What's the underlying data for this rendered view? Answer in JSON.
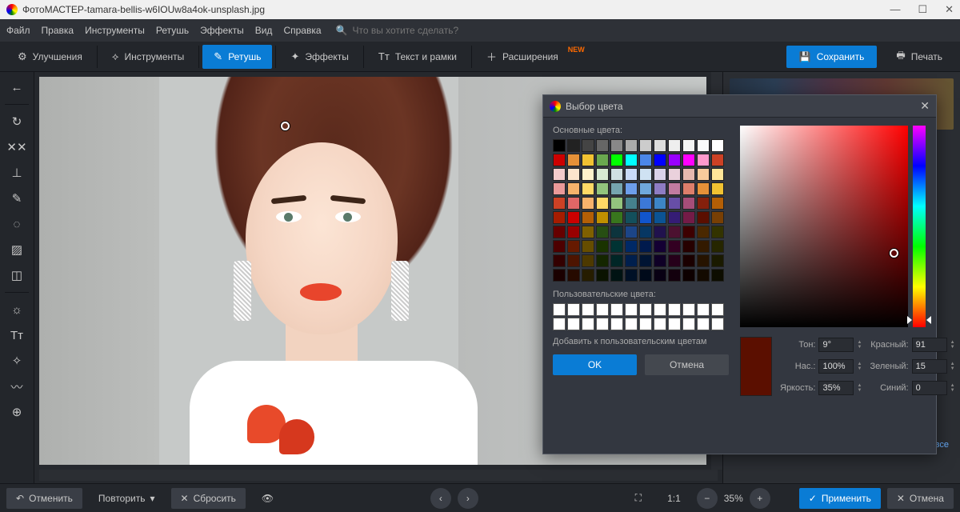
{
  "titlebar": {
    "app": "ФотоМАСТЕР",
    "sep": " - ",
    "file": "tamara-bellis-w6IOUw8a4ok-unsplash.jpg"
  },
  "menu": {
    "items": [
      "Файл",
      "Правка",
      "Инструменты",
      "Ретушь",
      "Эффекты",
      "Вид",
      "Справка"
    ],
    "search_placeholder": "Что вы хотите сделать?"
  },
  "toolbar": {
    "tabs": [
      {
        "label": "Улучшения"
      },
      {
        "label": "Инструменты"
      },
      {
        "label": "Ретушь",
        "active": true
      },
      {
        "label": "Эффекты"
      },
      {
        "label": "Текст и рамки"
      },
      {
        "label": "Расширения",
        "new": "NEW"
      }
    ],
    "save": "Сохранить",
    "print": "Печать"
  },
  "footer": {
    "undo": "Отменить",
    "redo": "Повторить",
    "reset": "Сбросить",
    "zoom_ratio": "1:1",
    "zoom_pct": "35%",
    "apply": "Применить",
    "cancel": "Отмена",
    "reset_all": "Сбросить все"
  },
  "picker": {
    "title": "Выбор цвета",
    "basic_label": "Основные цвета:",
    "custom_label": "Пользовательские цвета:",
    "add_custom": "Добавить к пользовательским цветам",
    "ok": "OK",
    "cancel": "Отмена",
    "hue_label": "Тон:",
    "sat_label": "Нас.:",
    "val_label": "Яркость:",
    "r_label": "Красный:",
    "g_label": "Зеленый:",
    "b_label": "Синий:",
    "hue": "9°",
    "sat": "100%",
    "val": "35%",
    "r": "91",
    "g": "15",
    "b": "0",
    "preview_color": "#5b0f00",
    "basic_colors": [
      "#000000",
      "#222222",
      "#444444",
      "#666666",
      "#888888",
      "#aaaaaa",
      "#cccccc",
      "#dddddd",
      "#eeeeee",
      "#f5f5f5",
      "#fafafa",
      "#ffffff",
      "#cc0000",
      "#e69138",
      "#f1c232",
      "#6aa84f",
      "#00ff00",
      "#00ffff",
      "#4a86e8",
      "#0000ff",
      "#9900ff",
      "#ff00ff",
      "#ff99cc",
      "#cc4125",
      "#f4cccc",
      "#fce5cd",
      "#fff2cc",
      "#d9ead3",
      "#d0e0e3",
      "#c9daf8",
      "#cfe2f3",
      "#d9d2e9",
      "#ead1dc",
      "#e6b8af",
      "#f9cb9c",
      "#ffe599",
      "#ea9999",
      "#f6b26b",
      "#ffd966",
      "#93c47d",
      "#76a5af",
      "#6d9eeb",
      "#6fa8dc",
      "#8e7cc3",
      "#c27ba0",
      "#dd7e6b",
      "#e69138",
      "#f1c232",
      "#cc4125",
      "#e06666",
      "#f6b26b",
      "#ffd966",
      "#93c47d",
      "#45818e",
      "#3c78d8",
      "#3d85c6",
      "#674ea7",
      "#a64d79",
      "#85200c",
      "#b45f06",
      "#a61c00",
      "#cc0000",
      "#b45f06",
      "#bf9000",
      "#38761d",
      "#134f5c",
      "#1155cc",
      "#0b5394",
      "#351c75",
      "#741b47",
      "#5b0f00",
      "#783f04",
      "#660000",
      "#990000",
      "#7f6000",
      "#274e13",
      "#0c343d",
      "#1c4587",
      "#073763",
      "#20124d",
      "#4c1130",
      "#3d0000",
      "#4a2800",
      "#333300",
      "#4d0000",
      "#661a00",
      "#664d00",
      "#1a3300",
      "#003333",
      "#002966",
      "#001a4d",
      "#140033",
      "#330022",
      "#260000",
      "#331a00",
      "#262600",
      "#330000",
      "#4d1400",
      "#4d3900",
      "#142600",
      "#002626",
      "#001f4d",
      "#001433",
      "#0f0026",
      "#26001a",
      "#1a0000",
      "#261300",
      "#1a1a00",
      "#1a0000",
      "#260a00",
      "#261d00",
      "#0a1300",
      "#001313",
      "#001026",
      "#000a1a",
      "#080013",
      "#13000d",
      "#0d0000",
      "#130a00",
      "#0d0d00"
    ]
  }
}
